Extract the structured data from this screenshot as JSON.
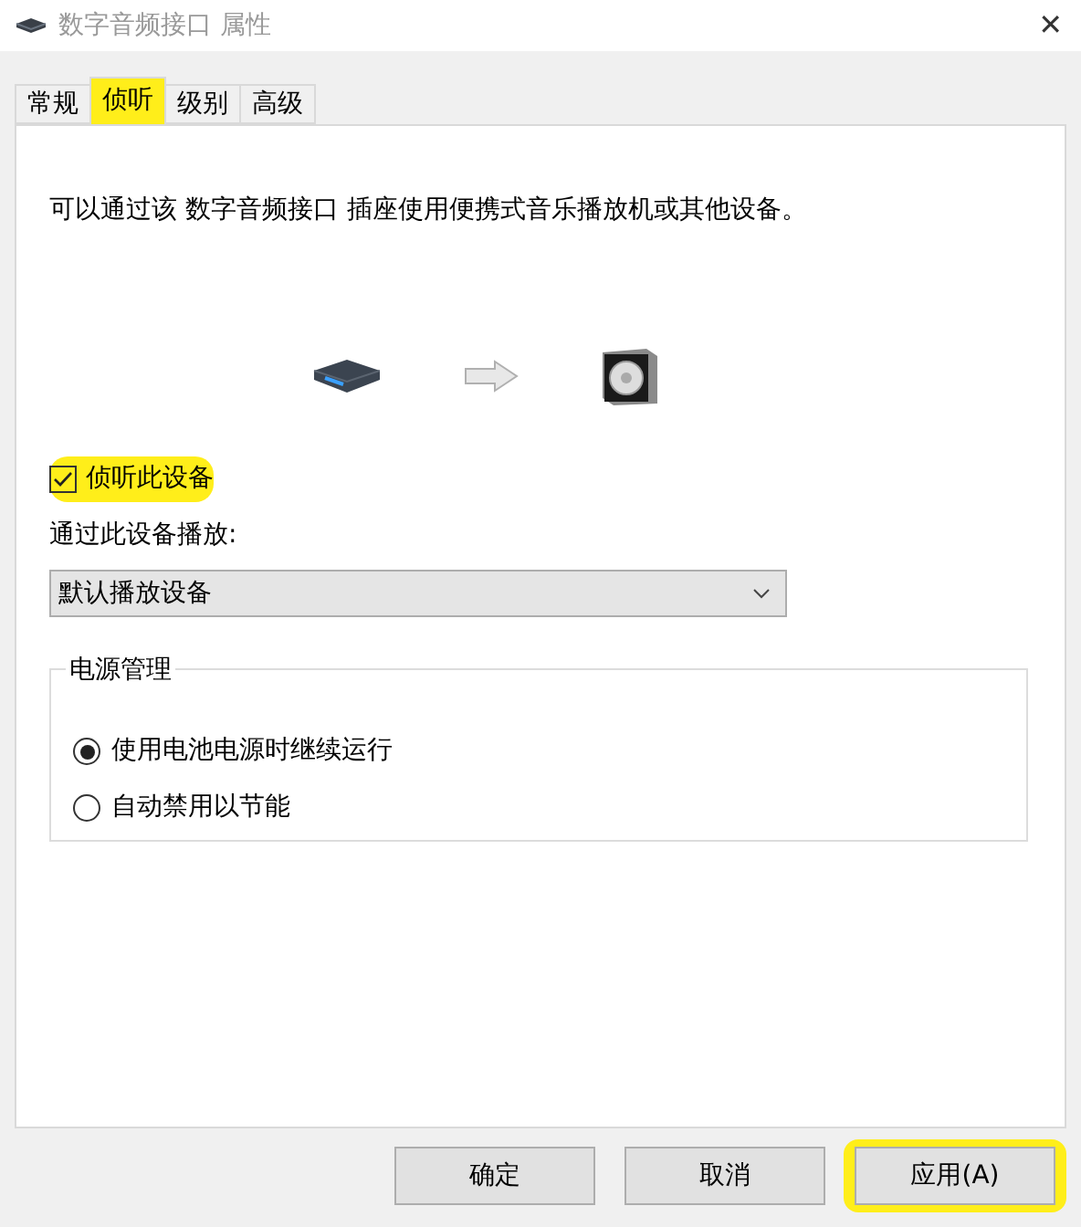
{
  "window": {
    "title": "数字音频接口 属性",
    "close": "✕"
  },
  "tabs": [
    {
      "label": "常规",
      "selected": false,
      "highlighted": false
    },
    {
      "label": "侦听",
      "selected": true,
      "highlighted": true
    },
    {
      "label": "级别",
      "selected": false,
      "highlighted": false
    },
    {
      "label": "高级",
      "selected": false,
      "highlighted": false
    }
  ],
  "description": "可以通过该 数字音频接口 插座使用便携式音乐播放机或其他设备。",
  "listen": {
    "label": "侦听此设备",
    "checked": true,
    "highlighted": true
  },
  "playback": {
    "label": "通过此设备播放:",
    "value": "默认播放设备"
  },
  "power": {
    "title": "电源管理",
    "options": [
      {
        "label": "使用电池电源时继续运行",
        "selected": true
      },
      {
        "label": "自动禁用以节能",
        "selected": false
      }
    ]
  },
  "buttons": [
    {
      "label": "确定",
      "highlighted": false
    },
    {
      "label": "取消",
      "highlighted": false
    },
    {
      "label": "应用(A)",
      "highlighted": true
    }
  ]
}
